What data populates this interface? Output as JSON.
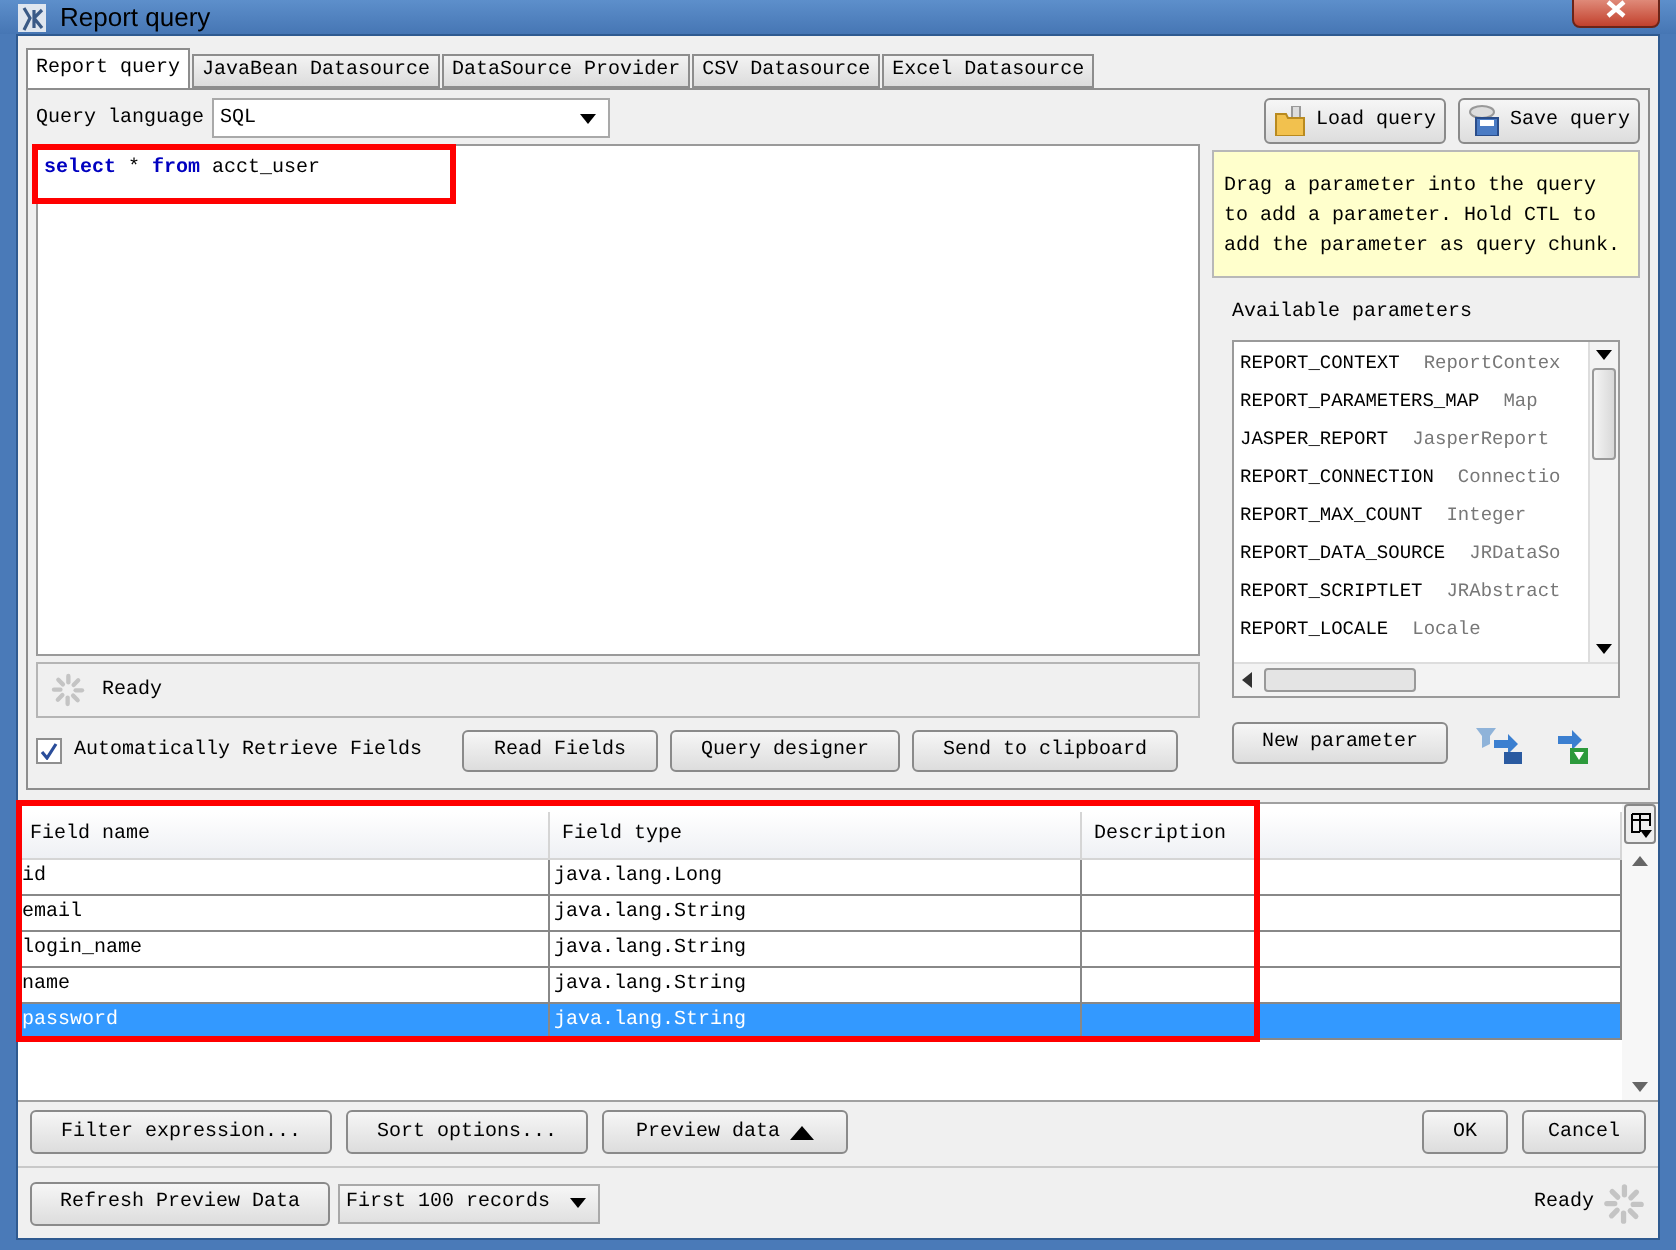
{
  "window": {
    "title": "Report query"
  },
  "tabs": [
    {
      "label": "Report query",
      "selected": true
    },
    {
      "label": "JavaBean Datasource",
      "selected": false
    },
    {
      "label": "DataSource Provider",
      "selected": false
    },
    {
      "label": "CSV Datasource",
      "selected": false
    },
    {
      "label": "Excel Datasource",
      "selected": false
    }
  ],
  "query_language": {
    "label": "Query language",
    "value": "SQL"
  },
  "query_tokens": [
    {
      "text": "select",
      "kind": "keyword"
    },
    {
      "text": "*",
      "kind": "plain"
    },
    {
      "text": "from",
      "kind": "keyword"
    },
    {
      "text": "acct_user",
      "kind": "plain"
    }
  ],
  "file_buttons": [
    "Load query",
    "Save query"
  ],
  "hint": "Drag a parameter into the query to add a parameter. Hold CTL to add the parameter as query chunk.",
  "parameters_label": "Available parameters",
  "parameters": [
    {
      "name": "REPORT_CONTEXT",
      "type": "ReportContex"
    },
    {
      "name": "REPORT_PARAMETERS_MAP",
      "type": "Map"
    },
    {
      "name": "JASPER_REPORT",
      "type": "JasperReport"
    },
    {
      "name": "REPORT_CONNECTION",
      "type": "Connectio"
    },
    {
      "name": "REPORT_MAX_COUNT",
      "type": "Integer"
    },
    {
      "name": "REPORT_DATA_SOURCE",
      "type": "JRDataSo"
    },
    {
      "name": "REPORT_SCRIPTLET",
      "type": "JRAbstract"
    },
    {
      "name": "REPORT_LOCALE",
      "type": "Locale"
    }
  ],
  "new_parameter": "New parameter",
  "status": "Ready",
  "auto_retrieve": {
    "label": "Automatically Retrieve Fields",
    "checked": true
  },
  "editor_buttons": [
    "Read Fields",
    "Query designer",
    "Send to clipboard"
  ],
  "fields_table": {
    "columns": [
      "Field name",
      "Field type",
      "Description"
    ],
    "rows": [
      {
        "cells": [
          "id",
          "java.lang.Long"
        ],
        "selected": false
      },
      {
        "cells": [
          "email",
          "java.lang.String"
        ],
        "selected": false
      },
      {
        "cells": [
          "login_name",
          "java.lang.String"
        ],
        "selected": false
      },
      {
        "cells": [
          "name",
          "java.lang.String"
        ],
        "selected": false
      },
      {
        "cells": [
          "password",
          "java.lang.String"
        ],
        "selected": true
      }
    ]
  },
  "table_buttons": [
    "Filter expression...",
    "Sort options...",
    "Preview data"
  ],
  "dialog_buttons": [
    "OK",
    "Cancel"
  ],
  "footer": {
    "refresh": "Refresh Preview Data",
    "records": "First 100 records",
    "status": "Ready"
  }
}
